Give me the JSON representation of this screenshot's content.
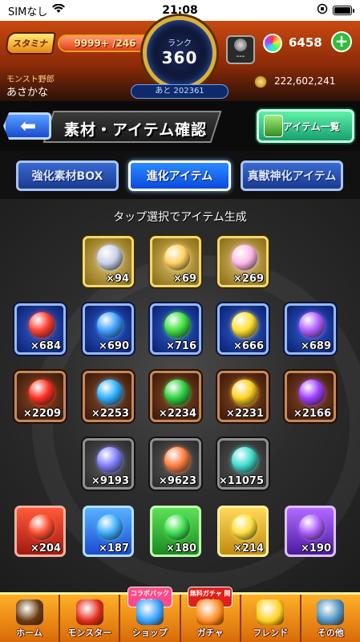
{
  "status_bar": {
    "carrier": "SIMなし",
    "time": "21:08"
  },
  "header": {
    "stamina_label": "スタミナ",
    "stamina_value": "9999+ /246",
    "rank_label": "ランク",
    "rank_value": "360",
    "next_exp": "あと 202361",
    "username_label": "モンスト野郎",
    "username": "あさかな",
    "item_slot_text": "---",
    "orbs": "6458",
    "gold": "222,602,241"
  },
  "titlebar": {
    "title": "素材・アイテム確認",
    "item_list_button": "アイテム一覧"
  },
  "tabs": [
    "強化素材BOX",
    "進化アイテム",
    "真獣神化アイテム"
  ],
  "main": {
    "hint": "タップ選択でアイテム生成",
    "rows": [
      {
        "frame": "gold",
        "items": [
          {
            "icon": "fortress-emblem-icon",
            "count": "×94",
            "color": "#c8d0e8"
          },
          {
            "icon": "rainbow-swirl-icon",
            "count": "×69",
            "color": "#ffd060"
          },
          {
            "icon": "rainbow-gem-icon",
            "count": "×269",
            "color": "#ffb8e8"
          }
        ]
      },
      {
        "frame": "blue",
        "items": [
          {
            "icon": "fire-orb-icon",
            "count": "×684",
            "color": "#ff4030"
          },
          {
            "icon": "water-orb-icon",
            "count": "×690",
            "color": "#40a0ff"
          },
          {
            "icon": "wood-orb-icon",
            "count": "×716",
            "color": "#40e040"
          },
          {
            "icon": "light-orb-icon",
            "count": "×666",
            "color": "#ffe030"
          },
          {
            "icon": "dark-orb-icon",
            "count": "×689",
            "color": "#b060ff"
          }
        ]
      },
      {
        "frame": "brown",
        "items": [
          {
            "icon": "fire-crystal-icon",
            "count": "×2209",
            "color": "#ff3020"
          },
          {
            "icon": "water-crystal-icon",
            "count": "×2253",
            "color": "#30b0ff"
          },
          {
            "icon": "wood-crystal-icon",
            "count": "×2234",
            "color": "#30d040"
          },
          {
            "icon": "light-crystal-icon",
            "count": "×2231",
            "color": "#ffd020"
          },
          {
            "icon": "dark-crystal-icon",
            "count": "×2166",
            "color": "#a040ff"
          }
        ]
      },
      {
        "frame": "gray",
        "items": [
          {
            "icon": "large-gem-icon",
            "count": "×9193",
            "color": "#8080ff"
          },
          {
            "icon": "medium-gem-icon",
            "count": "×9623",
            "color": "#ff8040"
          },
          {
            "icon": "small-gem-icon",
            "count": "×11075",
            "color": "#40e0d0"
          }
        ]
      },
      {
        "frame": "element",
        "items": [
          {
            "icon": "fire-sphere-icon",
            "count": "×204",
            "color": "fire"
          },
          {
            "icon": "water-sphere-icon",
            "count": "×187",
            "color": "water"
          },
          {
            "icon": "wood-sphere-icon",
            "count": "×180",
            "color": "wood"
          },
          {
            "icon": "light-sphere-icon",
            "count": "×214",
            "color": "light"
          },
          {
            "icon": "dark-sphere-icon",
            "count": "×190",
            "color": "dark"
          }
        ]
      }
    ]
  },
  "navbar": {
    "items": [
      {
        "label": "ホーム",
        "icon": "home-icon",
        "color": "#6a3a10"
      },
      {
        "label": "モンスター",
        "icon": "monster-icon",
        "color": "#e02a1a"
      },
      {
        "label": "ショップ",
        "icon": "shop-icon",
        "color": "#30a0ff",
        "badge": "コラボパック 登場！"
      },
      {
        "label": "ガチャ",
        "icon": "gacha-icon",
        "color": "#ff8a20",
        "badge": "無料ガチャ 開催中"
      },
      {
        "label": "フレンド",
        "icon": "friend-icon",
        "color": "#ffd020"
      },
      {
        "label": "その他",
        "icon": "other-icon",
        "color": "#4a90c0"
      }
    ]
  }
}
